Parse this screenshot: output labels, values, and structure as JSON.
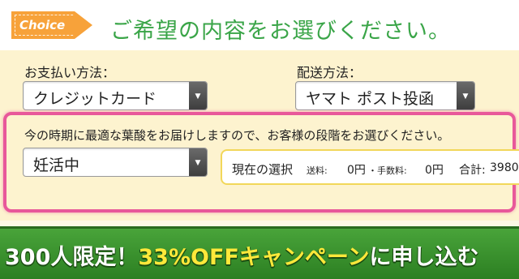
{
  "header": {
    "badge": "Choice",
    "heading": "ご希望の内容をお選びください。"
  },
  "payment": {
    "label": "お支払い方法：",
    "value": "クレジットカード"
  },
  "shipping": {
    "label": "配送方法：",
    "value": "ヤマト ポスト投函"
  },
  "stage": {
    "instruction": "今の時期に最適な葉酸をお届けしますので、お客様の段階をお選びください。",
    "value": "妊活中"
  },
  "summary": {
    "title": "現在の選択",
    "shipping_label": "送料:",
    "shipping_value": "0円",
    "fee_label": "・手数料:",
    "fee_value": "0円",
    "total_label": "合計:",
    "total_value": "3980"
  },
  "cta": {
    "part1": "300人限定！",
    "part2": "33%OFFキャンペーン",
    "part3": "に申し込む"
  },
  "colors": {
    "heading": "#3aa548",
    "badge": "#f7a23a",
    "highlight_frame": "#e8589a",
    "cta": "#3b9a2e",
    "cta_highlight": "#ffe83a"
  }
}
